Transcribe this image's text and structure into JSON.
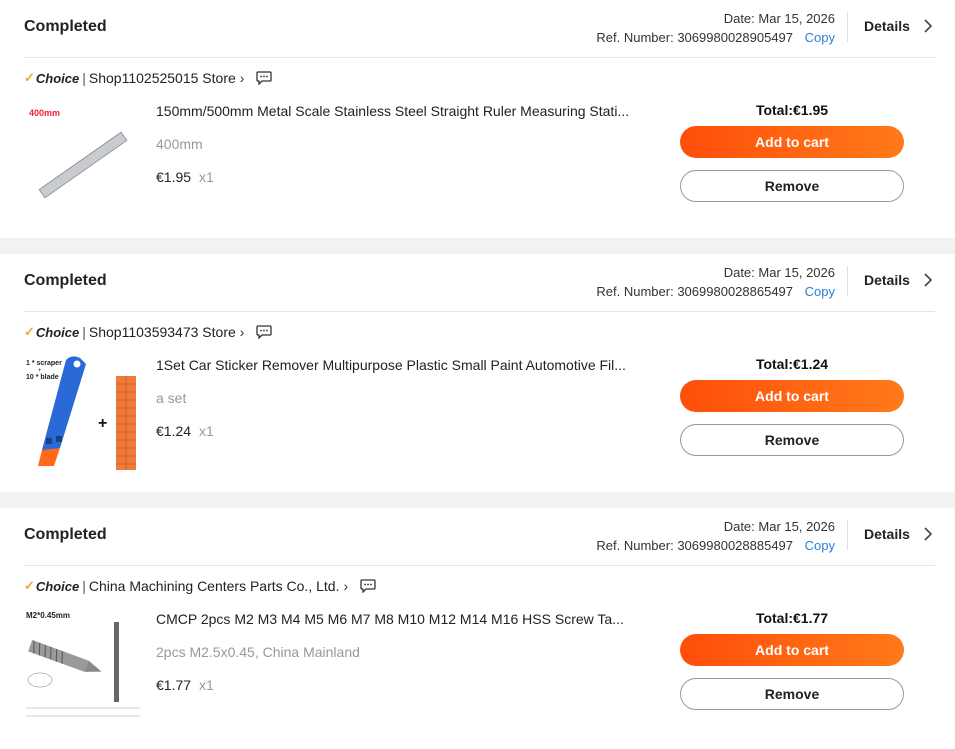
{
  "orders": [
    {
      "status": "Completed",
      "date": "Date: Mar 15, 2026",
      "ref_label": "Ref. Number:",
      "ref_number": "3069980028905497",
      "copy_label": "Copy",
      "details_label": "Details",
      "choice_label": "Choice",
      "store_name": "Shop1102525015 Store",
      "item_title": "150mm/500mm Metal Scale Stainless Steel Straight Ruler Measuring Stati...",
      "variant": "400mm",
      "price": "€1.95",
      "qty": "x1",
      "total": "Total:€1.95",
      "add_to_cart_label": "Add to cart",
      "remove_label": "Remove",
      "image_caption": "400mm"
    },
    {
      "status": "Completed",
      "date": "Date: Mar 15, 2026",
      "ref_label": "Ref. Number:",
      "ref_number": "3069980028865497",
      "copy_label": "Copy",
      "details_label": "Details",
      "choice_label": "Choice",
      "store_name": "Shop1103593473 Store",
      "item_title": "1Set Car Sticker Remover Multipurpose Plastic Small Paint Automotive Fil...",
      "variant": "a set",
      "price": "€1.24",
      "qty": "x1",
      "total": "Total:€1.24",
      "add_to_cart_label": "Add to cart",
      "remove_label": "Remove",
      "image_caption_1": "1 * scraper",
      "image_caption_2": "+",
      "image_caption_3": "10 * blade"
    },
    {
      "status": "Completed",
      "date": "Date: Mar 15, 2026",
      "ref_label": "Ref. Number:",
      "ref_number": "3069980028885497",
      "copy_label": "Copy",
      "details_label": "Details",
      "choice_label": "Choice",
      "store_name": "China Machining Centers Parts Co., Ltd.",
      "item_title": "CMCP 2pcs M2 M3 M4 M5 M6 M7 M8 M10 M12 M14 M16 HSS Screw Ta...",
      "variant": "2pcs M2.5x0.45, China Mainland",
      "price": "€1.77",
      "qty": "x1",
      "total": "Total:€1.77",
      "add_to_cart_label": "Add to cart",
      "remove_label": "Remove",
      "image_caption": "M2*0.45mm"
    }
  ],
  "icons": {
    "choice_tick": "✓",
    "chevron_right": "chevron-right-icon",
    "chat": "chat-bubble-icon"
  },
  "colors": {
    "accent_orange": "#ff5a10",
    "choice_gold": "#f5a623",
    "copy_blue": "#2b7fd6",
    "separator_gray": "#f2f2f2"
  }
}
